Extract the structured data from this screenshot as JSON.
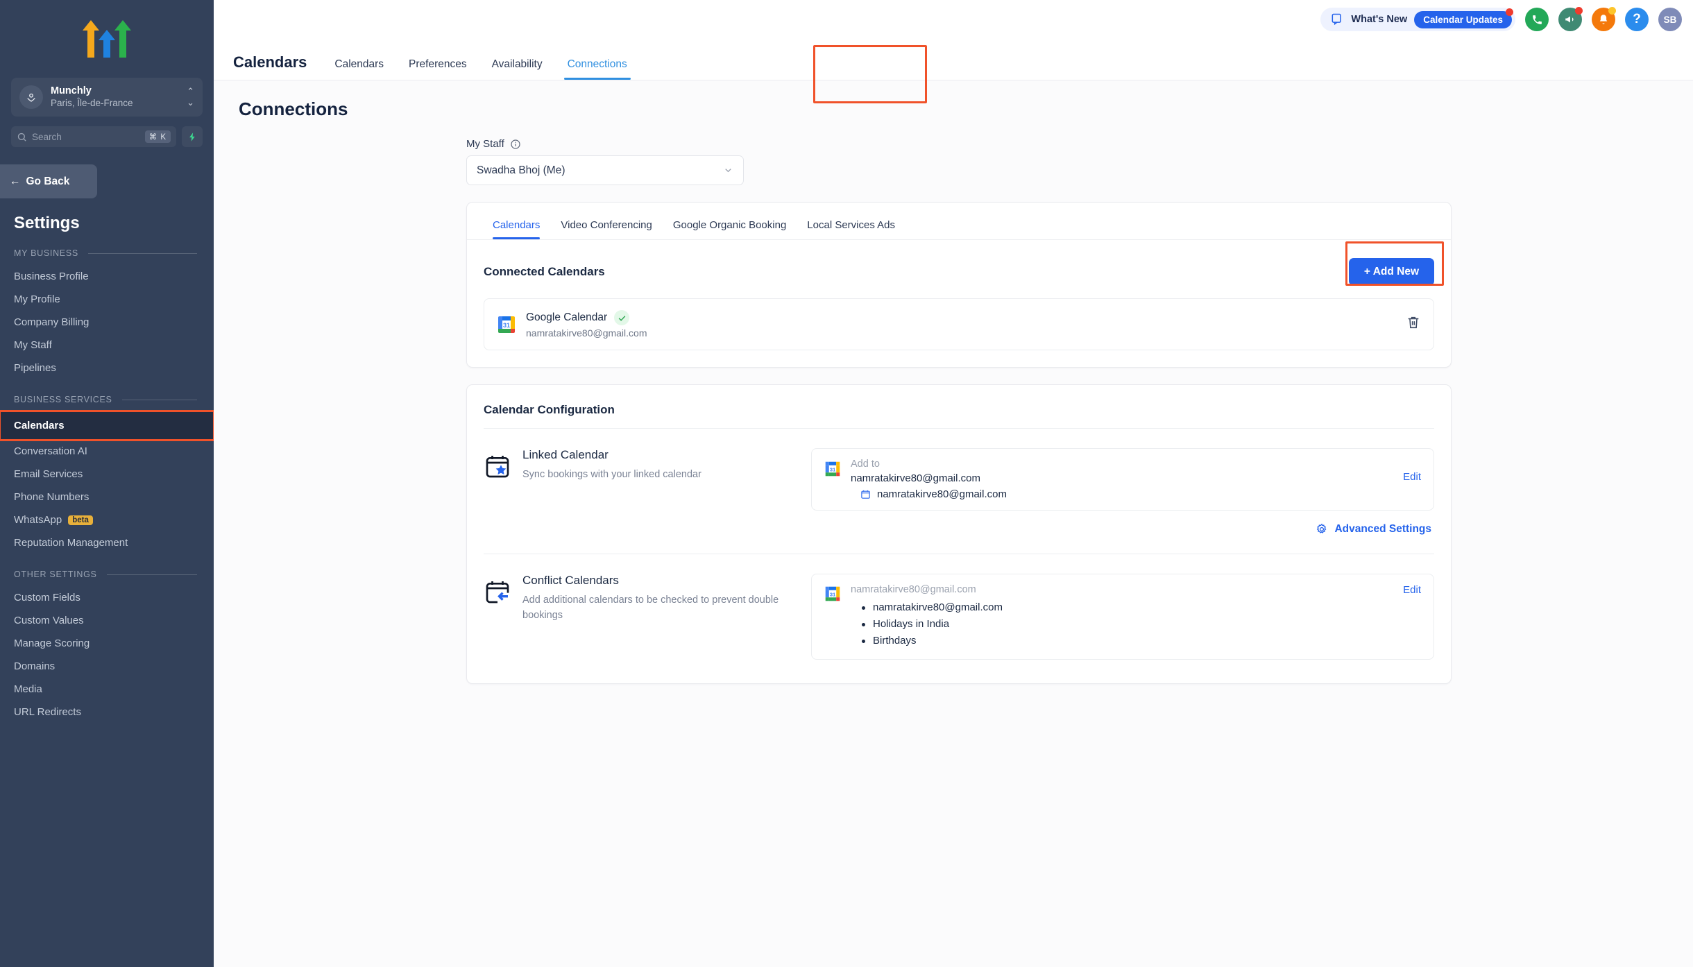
{
  "sidebar": {
    "logo_name": "growth-arrows-logo",
    "location": {
      "name": "Munchly",
      "sub": "Paris, Île-de-France"
    },
    "search": {
      "placeholder": "Search",
      "shortcut": "⌘ K"
    },
    "go_back": "Go Back",
    "settings_title": "Settings",
    "sections": [
      {
        "label": "MY BUSINESS",
        "items": [
          {
            "label": "Business Profile"
          },
          {
            "label": "My Profile"
          },
          {
            "label": "Company Billing"
          },
          {
            "label": "My Staff"
          },
          {
            "label": "Pipelines"
          }
        ]
      },
      {
        "label": "BUSINESS SERVICES",
        "items": [
          {
            "label": "Calendars",
            "active": true,
            "highlighted": true
          },
          {
            "label": "Conversation AI"
          },
          {
            "label": "Email Services"
          },
          {
            "label": "Phone Numbers"
          },
          {
            "label": "WhatsApp",
            "badge": "beta"
          },
          {
            "label": "Reputation Management"
          }
        ]
      },
      {
        "label": "OTHER SETTINGS",
        "items": [
          {
            "label": "Custom Fields"
          },
          {
            "label": "Custom Values"
          },
          {
            "label": "Manage Scoring"
          },
          {
            "label": "Domains"
          },
          {
            "label": "Media"
          },
          {
            "label": "URL Redirects"
          }
        ]
      }
    ]
  },
  "topbar": {
    "whats_new_label": "What's New",
    "whats_new_pill": "Calendar Updates",
    "icons": [
      {
        "name": "phone-icon",
        "color": "#23a858"
      },
      {
        "name": "megaphone-icon",
        "color": "#3f8a73"
      },
      {
        "name": "bell-icon",
        "color": "#f4790b"
      },
      {
        "name": "help-icon",
        "color": "#2b8ced"
      }
    ],
    "avatar_initials": "SB",
    "avatar_color": "#7f8bb8"
  },
  "navbar": {
    "title": "Calendars",
    "tabs": [
      {
        "label": "Calendars",
        "active": false
      },
      {
        "label": "Preferences",
        "active": false
      },
      {
        "label": "Availability",
        "active": false
      },
      {
        "label": "Connections",
        "active": true,
        "highlighted": true
      }
    ]
  },
  "page": {
    "title": "Connections",
    "staff_label": "My Staff",
    "staff_selected": "Swadha Bhoj (Me)"
  },
  "connections_card": {
    "tabs": [
      {
        "label": "Calendars",
        "active": true
      },
      {
        "label": "Video Conferencing",
        "active": false
      },
      {
        "label": "Google Organic Booking",
        "active": false
      },
      {
        "label": "Local Services Ads",
        "active": false
      }
    ],
    "section_title": "Connected Calendars",
    "add_button": "+ Add New",
    "connected": [
      {
        "icon": "google-calendar-icon",
        "name": "Google Calendar",
        "verified": true,
        "email": "namratakirve80@gmail.com",
        "delete_icon": "trash-icon"
      }
    ]
  },
  "configuration_card": {
    "title": "Calendar Configuration",
    "linked": {
      "icon": "calendar-star-icon",
      "heading": "Linked Calendar",
      "subtext": "Sync bookings with your linked calendar",
      "box": {
        "icon": "google-calendar-icon",
        "add_to_label": "Add to",
        "account": "namratakirve80@gmail.com",
        "calendar": "namratakirve80@gmail.com",
        "edit_label": "Edit"
      }
    },
    "advanced_settings": "Advanced Settings",
    "conflict": {
      "icon": "calendar-arrow-icon",
      "heading": "Conflict Calendars",
      "subtext": "Add additional calendars to be checked to prevent double bookings",
      "box": {
        "icon": "google-calendar-icon",
        "account": "namratakirve80@gmail.com",
        "calendars": [
          "namratakirve80@gmail.com",
          "Holidays in India",
          "Birthdays"
        ],
        "edit_label": "Edit"
      }
    }
  },
  "colors": {
    "sidebar_bg": "#33415a",
    "accent_blue": "#2563eb",
    "tab_blue": "#2f8fe0",
    "highlight_orange": "#f0522a",
    "beta_badge": "#e8b03a"
  }
}
